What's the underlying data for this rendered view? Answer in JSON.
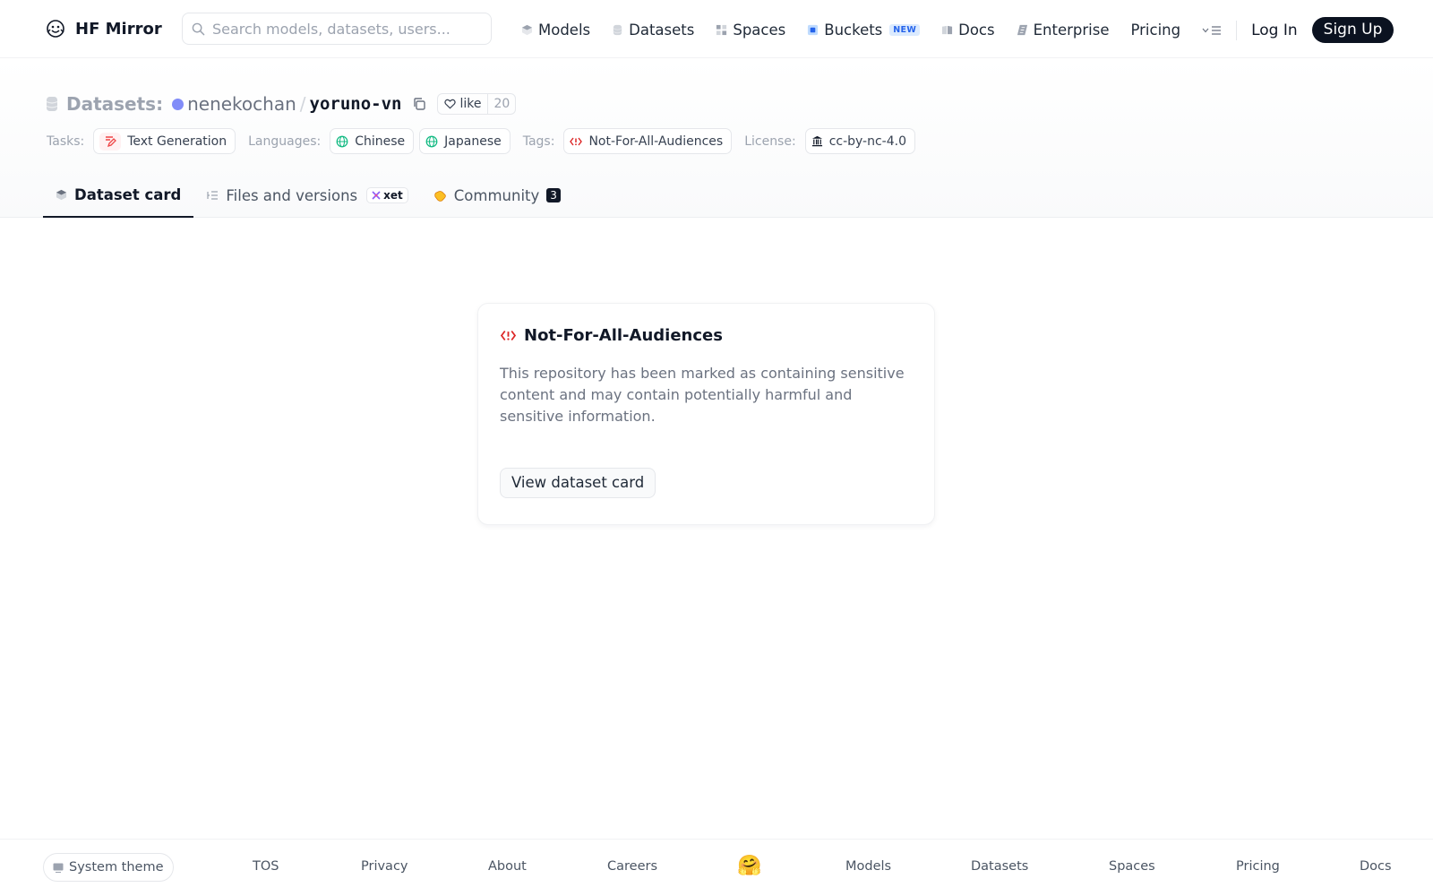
{
  "header": {
    "brand": "HF Mirror",
    "search_placeholder": "Search models, datasets, users...",
    "nav": {
      "models": "Models",
      "datasets": "Datasets",
      "spaces": "Spaces",
      "buckets": "Buckets",
      "buckets_badge": "NEW",
      "docs": "Docs",
      "enterprise": "Enterprise",
      "pricing": "Pricing"
    },
    "login": "Log In",
    "signup": "Sign Up"
  },
  "repo": {
    "type_label": "Datasets:",
    "owner": "nenekochan",
    "separator": "/",
    "name": "yoruno-vn",
    "like_label": "like",
    "like_count": "20"
  },
  "tags": {
    "tasks_label": "Tasks:",
    "task": "Text Generation",
    "languages_label": "Languages:",
    "languages": [
      "Chinese",
      "Japanese"
    ],
    "tags_label": "Tags:",
    "tag": "Not-For-All-Audiences",
    "license_label": "License:",
    "license": "cc-by-nc-4.0"
  },
  "tabs": {
    "dataset_card": "Dataset card",
    "files": "Files and versions",
    "xet": "xet",
    "community": "Community",
    "community_count": "3"
  },
  "warning": {
    "title": "Not-For-All-Audiences",
    "text": "This repository has been marked as containing sensitive content and may contain potentially harmful and sensitive information.",
    "button": "View dataset card"
  },
  "footer": {
    "theme": "System theme",
    "links": [
      "TOS",
      "Privacy",
      "About",
      "Careers",
      "Models",
      "Datasets",
      "Spaces",
      "Pricing",
      "Docs"
    ],
    "emoji": "🤗"
  },
  "colors": {
    "accent_dark": "#0b1220",
    "nsfw_red": "#dc2626",
    "language_green": "#10b981",
    "owner_avatar": "#818cf8"
  }
}
